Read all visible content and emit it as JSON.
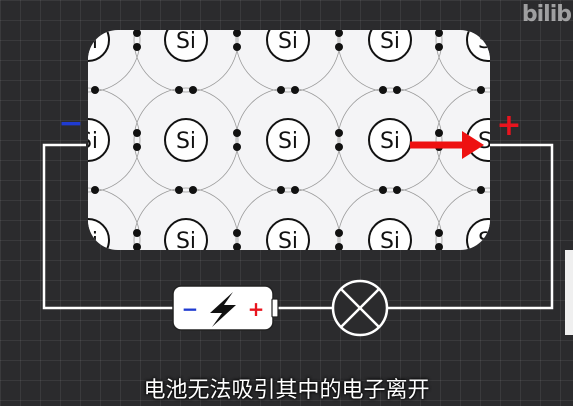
{
  "watermark": "bilib",
  "subtitle": "电池无法吸引其中的电子离开",
  "atom_label": "Si",
  "left_terminal": "−",
  "right_terminal": "+",
  "battery": {
    "negative": "−",
    "positive": "+"
  },
  "colors": {
    "background": "#2b2b2d",
    "wire": "#ffffff",
    "crystal": "#f4f4f6",
    "negative": "#1f3bd1",
    "positive": "#e8141e",
    "arrow": "#ee1111"
  },
  "icons": [
    "lightning-icon",
    "lamp-icon",
    "arrow-icon"
  ]
}
